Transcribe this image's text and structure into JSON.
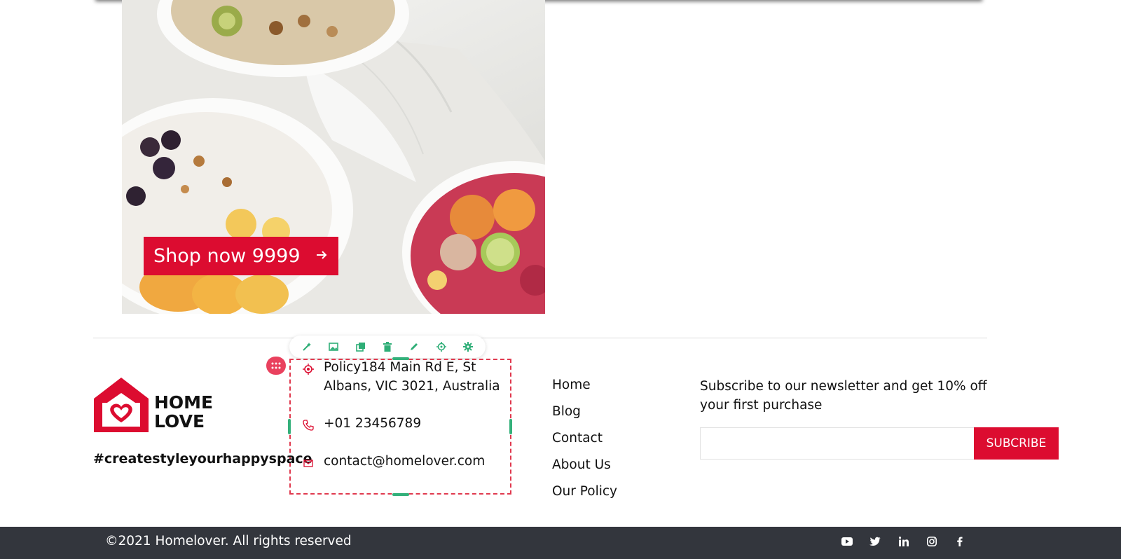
{
  "hero": {
    "shop_button_label": "Shop now 9999",
    "shop_button_icon": "arrow-right-icon"
  },
  "editor_toolbar": {
    "icons": [
      "magic-wand-icon",
      "image-icon",
      "duplicate-icon",
      "trash-icon",
      "pencil-icon",
      "target-icon",
      "gear-icon"
    ],
    "accent": "#2fae77",
    "grip_icon": "grip-dots-icon",
    "selection_color": "#e03a4f"
  },
  "brand": {
    "logo_line1": "HOME",
    "logo_line2": "LOVE",
    "hashtag": "#createstyleyourhappyspace",
    "color": "#dc0c30"
  },
  "contact": {
    "address_line1": "Policy184 Main Rd E, St",
    "address_line2": "Albans, VIC 3021, Australia",
    "phone": "+01 23456789",
    "email": "contact@homelover.com"
  },
  "nav": {
    "items": [
      {
        "label": "Home"
      },
      {
        "label": "Blog"
      },
      {
        "label": "Contact"
      },
      {
        "label": "About Us"
      },
      {
        "label": "Our Policy"
      }
    ]
  },
  "newsletter": {
    "text": "Subscribe to our newsletter and get 10% off your first purchase",
    "input_placeholder": "",
    "button_label": "SUBCRIBE"
  },
  "footer": {
    "copyright": "©2021 Homelover. All rights reserved",
    "social": [
      "youtube-icon",
      "twitter-icon",
      "linkedin-icon",
      "instagram-icon",
      "facebook-icon"
    ],
    "bar_color": "#33363d"
  }
}
